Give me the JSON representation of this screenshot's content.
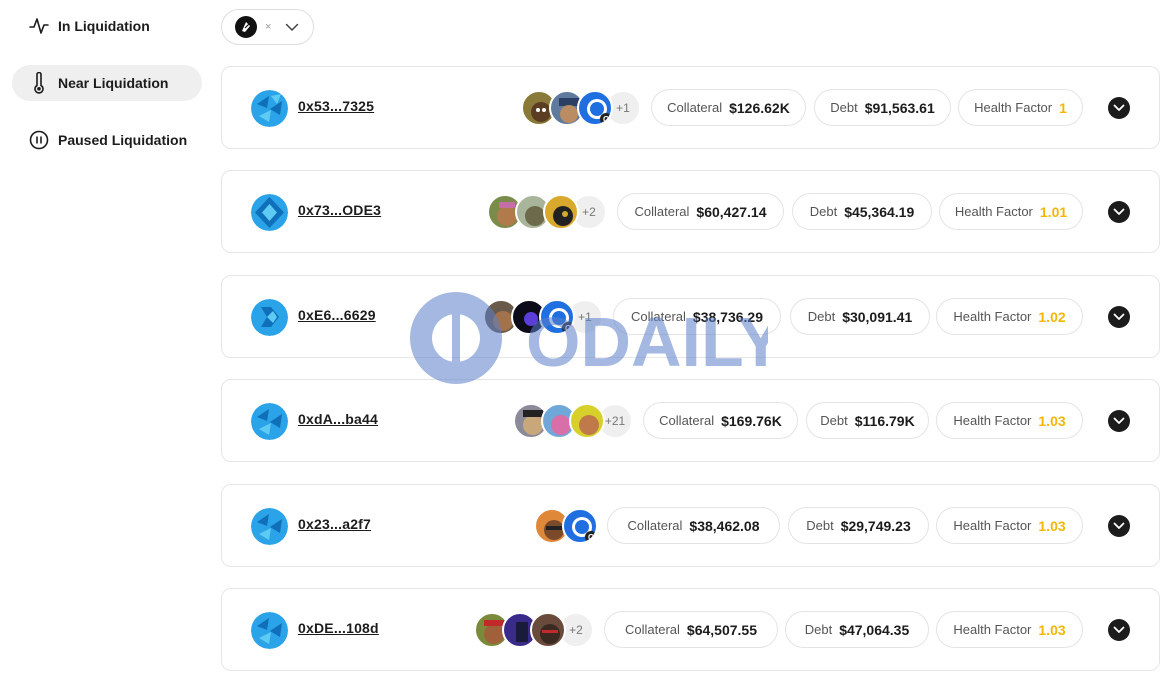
{
  "sidebar": {
    "items": [
      {
        "label": "In Liquidation",
        "icon": "activity-icon",
        "active": false
      },
      {
        "label": "Near Liquidation",
        "icon": "thermometer-icon",
        "active": true
      },
      {
        "label": "Paused Liquidation",
        "icon": "pause-circle-icon",
        "active": false
      }
    ]
  },
  "filter": {
    "clear_label": "×",
    "collection_icon": "collection-logo-icon"
  },
  "labels": {
    "collateral": "Collateral",
    "debt": "Debt",
    "health_factor": "Health Factor"
  },
  "colors": {
    "health_factor_normal": "#1c1c1c",
    "health_factor_warn": "#f2b705",
    "active_nav_bg": "#efefef"
  },
  "rows": [
    {
      "address": "0x53...7325",
      "nft_more": "+1",
      "collateral": "$126.62K",
      "debt": "$91,563.61",
      "health_factor": "1"
    },
    {
      "address": "0x73...ODE3",
      "nft_more": "+2",
      "collateral": "$60,427.14",
      "debt": "$45,364.19",
      "health_factor": "1.01"
    },
    {
      "address": "0xE6...6629",
      "nft_more": "+1",
      "collateral": "$38,736.29",
      "debt": "$30,091.41",
      "health_factor": "1.02"
    },
    {
      "address": "0xdA...ba44",
      "nft_more": "+21",
      "collateral": "$169.76K",
      "debt": "$116.79K",
      "health_factor": "1.03"
    },
    {
      "address": "0x23...a2f7",
      "nft_more": "",
      "collateral": "$38,462.08",
      "debt": "$29,749.23",
      "health_factor": "1.03"
    },
    {
      "address": "0xDE...108d",
      "nft_more": "+2",
      "collateral": "$64,507.55",
      "debt": "$47,064.35",
      "health_factor": "1.03"
    }
  ],
  "watermark": {
    "text": "ODAILY"
  }
}
